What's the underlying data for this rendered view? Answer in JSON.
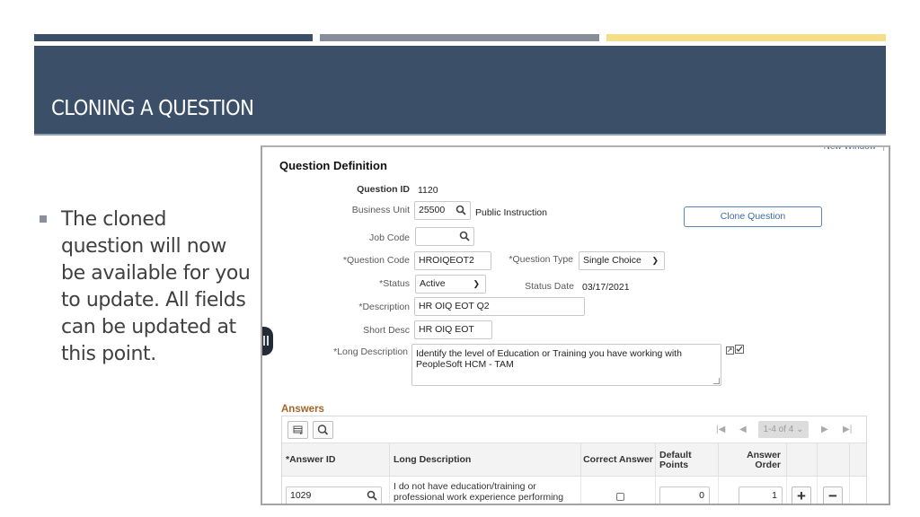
{
  "slide": {
    "title": "CLONING A QUESTION",
    "bullet": "The cloned question will now be available for you to update.  All fields can be updated at this point.",
    "colors": {
      "primary": "#3b5068",
      "secondary": "#878d99",
      "accent": "#f6dd8a"
    }
  },
  "app": {
    "top_link": "New Window",
    "section_title": "Question Definition",
    "fields": {
      "question_id": {
        "label": "Question ID",
        "value": "1120"
      },
      "business_unit": {
        "label": "Business Unit",
        "value": "25500",
        "description": "Public Instruction"
      },
      "job_code": {
        "label": "Job Code",
        "value": ""
      },
      "question_code": {
        "label": "*Question Code",
        "value": "HROIQEOT2"
      },
      "question_type": {
        "label": "*Question Type",
        "value": "Single Choice"
      },
      "status": {
        "label": "*Status",
        "value": "Active"
      },
      "status_date": {
        "label": "Status Date",
        "value": "03/17/2021"
      },
      "description": {
        "label": "*Description",
        "value": "HR OIQ EOT Q2"
      },
      "short_desc": {
        "label": "Short Desc",
        "value": "HR OIQ EOT"
      },
      "long_description": {
        "label": "*Long Description",
        "value": "Identify the level of Education or Training you have working with PeopleSoft HCM - TAM"
      }
    },
    "clone_button": "Clone Question",
    "answers": {
      "title": "Answers",
      "pagination": "1-4 of 4",
      "columns": [
        "*Answer ID",
        "Long Description",
        "Correct Answer",
        "Default Points",
        "Answer Order"
      ],
      "rows": [
        {
          "answer_id": "1029",
          "long_description": "I do not have education/training or professional work experience performing this task",
          "correct": false,
          "default_points": "0",
          "answer_order": "1"
        }
      ]
    }
  }
}
